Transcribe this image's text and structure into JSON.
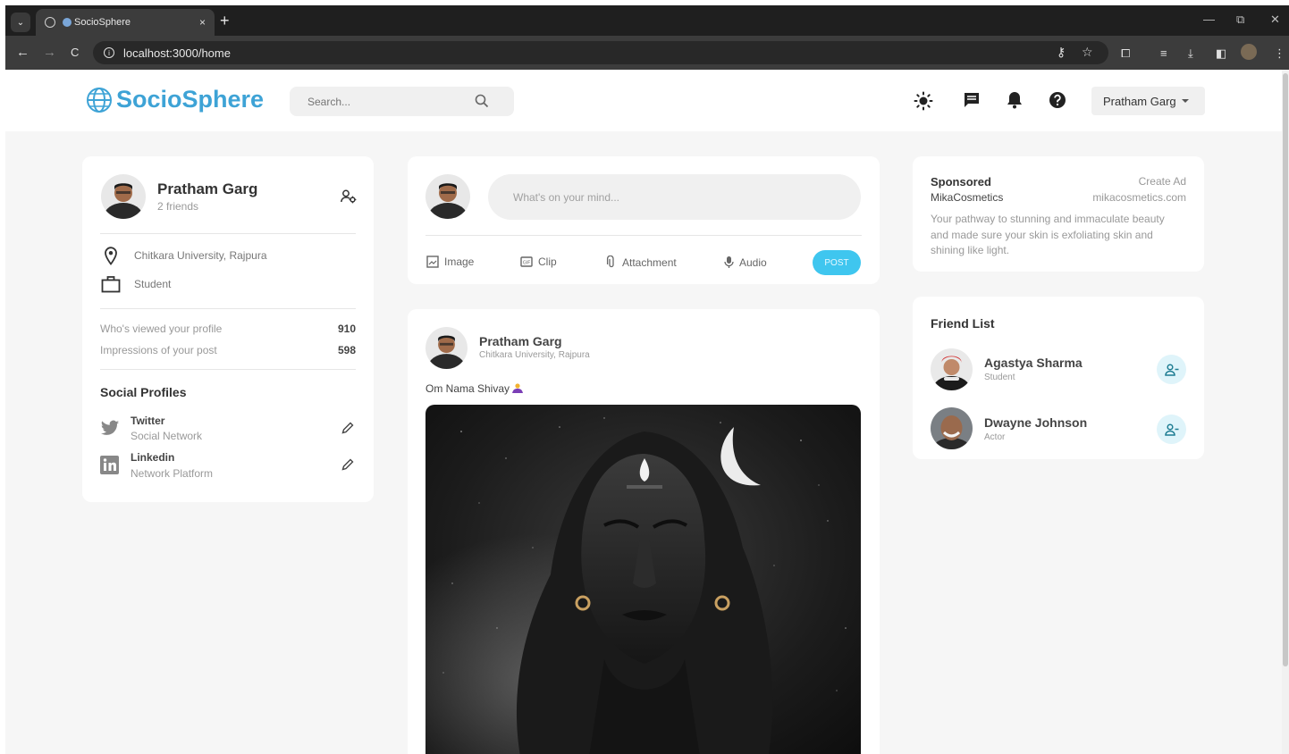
{
  "browser": {
    "tab_title": "SocioSphere",
    "tab_close": "×",
    "new_tab": "+",
    "url": "localhost:3000/home",
    "nav": {
      "back": "←",
      "forward": "→",
      "reload": "C"
    },
    "window": {
      "minimize": "—",
      "restore": "⧉",
      "close": "✕"
    }
  },
  "header": {
    "logo": "SocioSphere",
    "search_placeholder": "Search...",
    "user_menu": "Pratham Garg"
  },
  "profile": {
    "name": "Pratham Garg",
    "friends": "2 friends",
    "location": "Chitkara University, Rajpura",
    "occupation": "Student",
    "stats": [
      {
        "label": "Who's viewed your profile",
        "value": "910"
      },
      {
        "label": "Impressions of your post",
        "value": "598"
      }
    ],
    "social_title": "Social Profiles",
    "social": [
      {
        "name": "Twitter",
        "desc": "Social Network"
      },
      {
        "name": "Linkedin",
        "desc": "Network Platform"
      }
    ]
  },
  "composer": {
    "placeholder": "What's on your mind...",
    "actions": [
      "Image",
      "Clip",
      "Attachment",
      "Audio"
    ],
    "post_label": "POST"
  },
  "post": {
    "author": "Pratham Garg",
    "location": "Chitkara University, Rajpura",
    "text": "Om Nama Shivay"
  },
  "sponsored": {
    "title": "Sponsored",
    "create_ad": "Create Ad",
    "brand": "MikaCosmetics",
    "site": "mikacosmetics.com",
    "description": "Your pathway to stunning and immaculate beauty and made sure your skin is exfoliating skin and shining like light."
  },
  "friends": {
    "title": "Friend List",
    "items": [
      {
        "name": "Agastya Sharma",
        "role": "Student"
      },
      {
        "name": "Dwayne Johnson",
        "role": "Actor"
      }
    ]
  },
  "colors": {
    "brand": "#3ea3d6",
    "post_button": "#3fc6ef",
    "friend_button_bg": "#dff4fa"
  }
}
